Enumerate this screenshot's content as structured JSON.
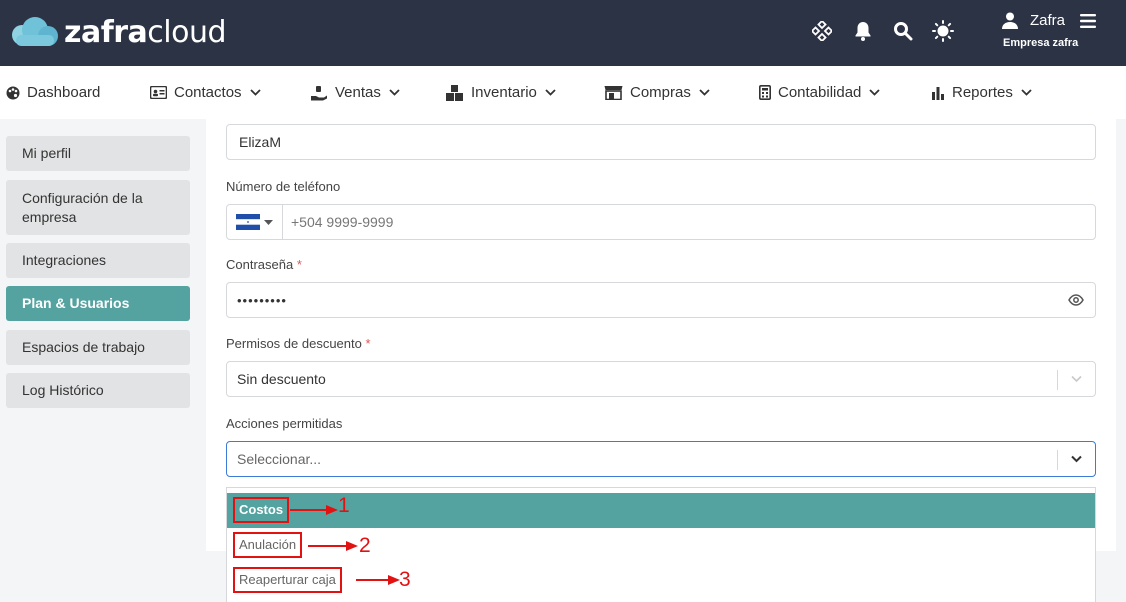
{
  "brand": {
    "bold": "zafra",
    "light": "cloud"
  },
  "header": {
    "icons": [
      "grid-diamond-icon",
      "bell-icon",
      "search-icon",
      "sun-icon"
    ],
    "user_name": "Zafra",
    "company": "Empresa zafra"
  },
  "nav": [
    {
      "label": "Dashboard",
      "icon": "palette-icon",
      "dropdown": false
    },
    {
      "label": "Contactos",
      "icon": "contact-card-icon",
      "dropdown": true
    },
    {
      "label": "Ventas",
      "icon": "hand-holding-icon",
      "dropdown": true
    },
    {
      "label": "Inventario",
      "icon": "boxes-icon",
      "dropdown": true
    },
    {
      "label": "Compras",
      "icon": "store-icon",
      "dropdown": true
    },
    {
      "label": "Contabilidad",
      "icon": "calculator-icon",
      "dropdown": true
    },
    {
      "label": "Reportes",
      "icon": "bar-chart-icon",
      "dropdown": true
    }
  ],
  "sidebar": {
    "items": [
      {
        "label": "Mi perfil"
      },
      {
        "label": "Configuración de la empresa"
      },
      {
        "label": "Integraciones"
      },
      {
        "label": "Plan & Usuarios",
        "active": true
      },
      {
        "label": "Espacios de trabajo"
      },
      {
        "label": "Log Histórico"
      }
    ]
  },
  "form": {
    "username_value": "ElizaM",
    "phone": {
      "label": "Número de teléfono",
      "placeholder": "+504 9999-9999"
    },
    "password": {
      "label": "Contraseña",
      "required_mark": "*",
      "value": "•••••••••"
    },
    "discount": {
      "label": "Permisos de descuento",
      "required_mark": "*",
      "value": "Sin descuento"
    },
    "actions": {
      "label": "Acciones permitidas",
      "placeholder": "Seleccionar..."
    }
  },
  "dropdown": {
    "options": [
      "Costos",
      "Anulación",
      "Reaperturar caja"
    ],
    "annotations": [
      "1",
      "2",
      "3"
    ]
  },
  "colors": {
    "header": "#2c3345",
    "accent": "#55a3a1",
    "annotation": "#e21212"
  }
}
